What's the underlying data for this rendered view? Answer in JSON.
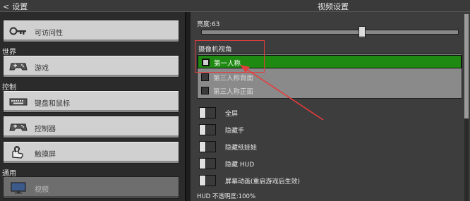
{
  "header": {
    "back_label": "设置",
    "right_title": "视频设置"
  },
  "left": {
    "buttons": [
      {
        "label": "可访问性",
        "icon": "key-icon"
      },
      {
        "label": "游戏",
        "icon": "gamepad-icon"
      },
      {
        "label": "键盘和鼠标",
        "icon": "keyboard-icon"
      },
      {
        "label": "控制器",
        "icon": "controller-icon"
      },
      {
        "label": "触摸屏",
        "icon": "touch-icon"
      },
      {
        "label": "视频",
        "icon": "monitor-icon"
      }
    ],
    "sections": [
      "世界",
      "控制",
      "通用"
    ]
  },
  "brightness": {
    "label": "亮度:63",
    "value": 63
  },
  "camera": {
    "label": "摄像机视角",
    "options": [
      "第一人称",
      "第三人称背面",
      "第三人称正面"
    ],
    "selected_index": 0
  },
  "toggles": [
    {
      "label": "全屏",
      "on": false
    },
    {
      "label": "隐藏手",
      "on": false
    },
    {
      "label": "隐藏纸娃娃",
      "on": false
    },
    {
      "label": "隐藏 HUD",
      "on": false
    },
    {
      "label": "屏幕动画(重启游戏后生效)",
      "on": false
    }
  ],
  "hud_opacity_label": "HUD 不透明度:100%",
  "colors": {
    "selected_green": "#1f8a12",
    "annotation_red": "#e53c3c",
    "button_grey": "#d0d0d0"
  }
}
